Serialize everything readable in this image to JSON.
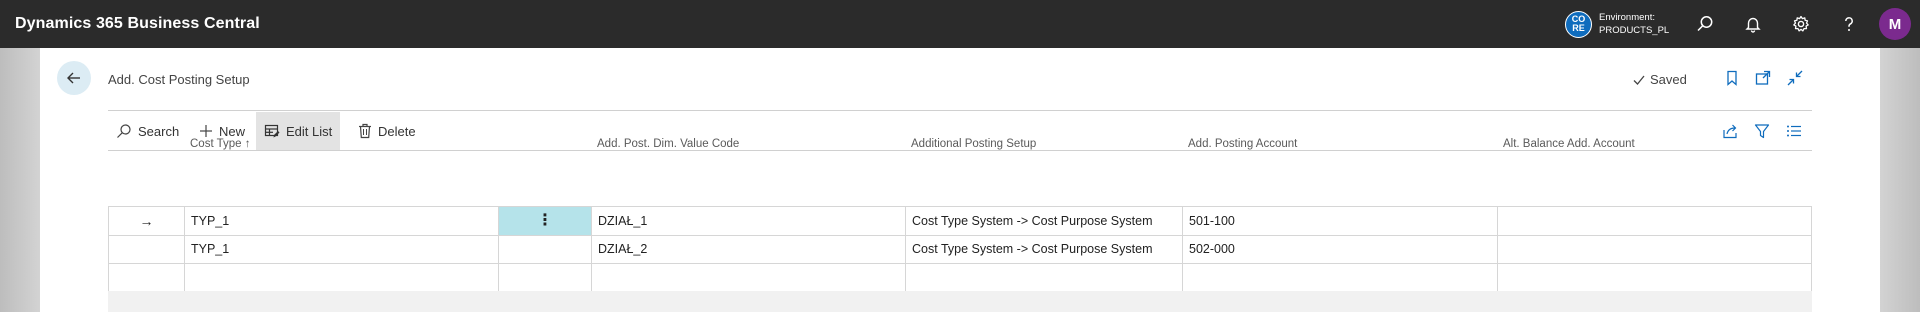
{
  "app": {
    "title": "Dynamics 365 Business Central"
  },
  "topbar": {
    "env_badge_line1": "CO",
    "env_badge_line2": "RE",
    "env_label": "Environment:",
    "env_name": "PRODUCTS_PL",
    "icons": [
      "search-icon",
      "bell-icon",
      "gear-icon",
      "help-icon"
    ],
    "avatar_initial": "M",
    "avatar_color": "#7b2a8e",
    "badge_color": "#0f6cbd"
  },
  "page": {
    "title": "Add. Cost Posting Setup",
    "status": "Saved"
  },
  "actions": {
    "search": "Search",
    "new": "New",
    "edit_list": "Edit List",
    "delete": "Delete"
  },
  "grid": {
    "columns": {
      "cost_type": "Cost Type",
      "dim_value_code": "Add. Post. Dim. Value Code",
      "additional_posting_setup": "Additional Posting Setup",
      "add_posting_account": "Add. Posting Account",
      "alt_balance_account": "Alt. Balance Add. Account"
    },
    "sort_indicator": "↑",
    "rows": [
      {
        "cost_type": "TYP_1",
        "dim_value_code": "DZIAŁ_1",
        "additional_posting_setup": "Cost Type System -> Cost Purpose System",
        "add_posting_account": "501-100",
        "alt_balance_account": ""
      },
      {
        "cost_type": "TYP_1",
        "dim_value_code": "DZIAŁ_2",
        "additional_posting_setup": "Cost Type System -> Cost Purpose System",
        "add_posting_account": "502-000",
        "alt_balance_account": ""
      }
    ],
    "selected_row_marker": "→",
    "row_menu_glyph": "⋮",
    "selected_cell_color": "#b5e3ea"
  }
}
